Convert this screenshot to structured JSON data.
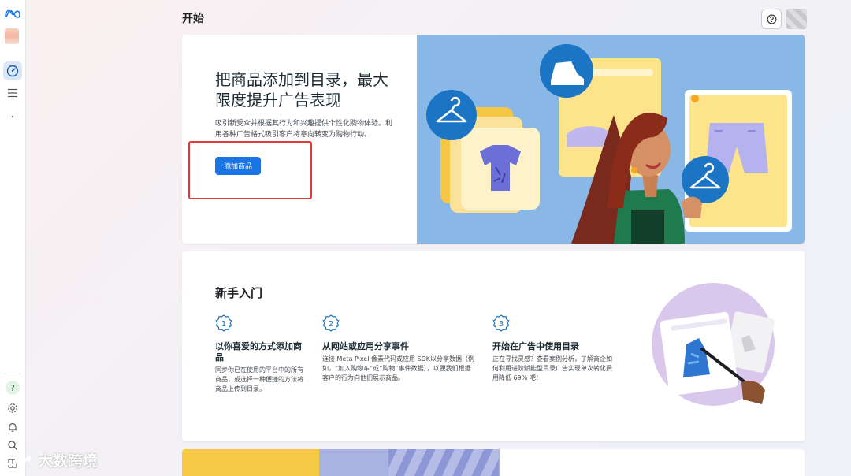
{
  "header": {
    "title": "开始"
  },
  "hero": {
    "title": "把商品添加到目录，最大限度提升广告表现",
    "description": "吸引新受众并根据其行为和兴趣提供个性化购物体验。利用各种广告格式吸引客户将意向转变为购物行动。",
    "button_label": "添加商品"
  },
  "getting_started": {
    "title": "新手入门",
    "steps": [
      {
        "number": "1",
        "title": "以你喜爱的方式添加商品",
        "description": "同步你已在使用的平台中的所有商品，或选择一种便捷的方法将商品上传到目录。"
      },
      {
        "number": "2",
        "title": "从网站或应用分享事件",
        "description": "连接 Meta Pixel 像素代码或应用 SDK以分享数据（例如，“加入购物车”或“购物”事件数据），以便我们根据客户的行为向他们展示商品。"
      },
      {
        "number": "3",
        "title": "开始在广告中使用目录",
        "description": "正在寻找灵感？查看案例分析，了解商企如何利用进阶赋能型目录广告实现单次转化费用降低 69% 吧！"
      }
    ]
  },
  "watermark": {
    "text": "大数跨境"
  },
  "colors": {
    "primary": "#1b74e4",
    "highlight": "#e53935",
    "hero_art_bg": "#8ab8e6"
  },
  "icons": [
    "meta-logo",
    "dashboard-icon",
    "menu-icon",
    "help-icon",
    "settings-icon",
    "bell-icon",
    "search-icon",
    "book-icon"
  ]
}
